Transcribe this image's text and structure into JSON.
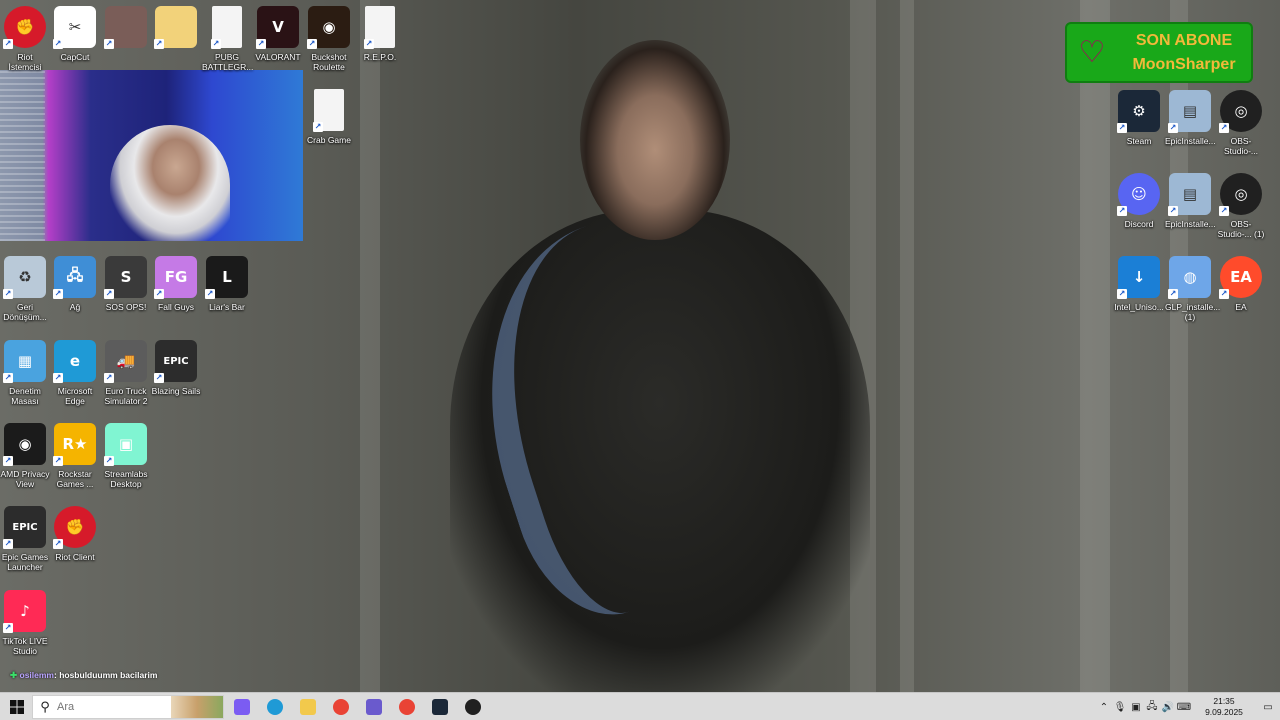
{
  "desktop_icons": [
    {
      "id": "riot-istemcisi",
      "label": "Riot İstemcisi",
      "icon": "riot-fist-icon",
      "color": "#d61a2a"
    },
    {
      "id": "capcut",
      "label": "CapCut",
      "icon": "capcut-icon",
      "color": "#ffffff"
    },
    {
      "id": "user-folder",
      "label": "",
      "icon": "user-photo-icon",
      "color": "#7a5d58"
    },
    {
      "id": "folder",
      "label": "",
      "icon": "folder-icon",
      "color": "#f2d27a"
    },
    {
      "id": "pubg",
      "label": "PUBG BATTLEGR...",
      "icon": "file-icon",
      "color": "#f4f4f4"
    },
    {
      "id": "valorant",
      "label": "VALORANT",
      "icon": "valorant-icon",
      "color": "#2a1215"
    },
    {
      "id": "buckshot",
      "label": "Buckshot Roulette",
      "icon": "buckshot-icon",
      "color": "#2b1c12"
    },
    {
      "id": "repo",
      "label": "R.E.P.O.",
      "icon": "file-icon",
      "color": "#f4f4f4"
    },
    {
      "id": "crab-game",
      "label": "Crab Game",
      "icon": "file-icon",
      "color": "#f4f4f4"
    },
    {
      "id": "geri-donusum",
      "label": "Geri Dönüşüm...",
      "icon": "recycle-bin-icon",
      "color": "#b9c9d8"
    },
    {
      "id": "ag",
      "label": "Ağ",
      "icon": "network-icon",
      "color": "#3f8ed6"
    },
    {
      "id": "sos-ops",
      "label": "SOS OPS!",
      "icon": "sos-ops-icon",
      "color": "#3a3a3a"
    },
    {
      "id": "fall-guys",
      "label": "Fall Guys",
      "icon": "fall-guys-icon",
      "color": "#c57ae6"
    },
    {
      "id": "liars-bar",
      "label": "Liar's Bar",
      "icon": "liars-bar-icon",
      "color": "#1a1a1a"
    },
    {
      "id": "denetim",
      "label": "Denetim Masası",
      "icon": "control-panel-icon",
      "color": "#4aa3df"
    },
    {
      "id": "edge",
      "label": "Microsoft Edge",
      "icon": "edge-icon",
      "color": "#1f9ad6"
    },
    {
      "id": "ets2",
      "label": "Euro Truck Simulator 2",
      "icon": "truck-icon",
      "color": "#5c5c5c"
    },
    {
      "id": "blazing-sails",
      "label": "Blazing Sails",
      "icon": "epic-games-icon",
      "color": "#2c2c2c"
    },
    {
      "id": "amd-privacy",
      "label": "AMD Privacy View",
      "icon": "amd-eye-icon",
      "color": "#1b1b1b"
    },
    {
      "id": "rockstar",
      "label": "Rockstar Games ...",
      "icon": "rockstar-icon",
      "color": "#f5b400"
    },
    {
      "id": "streamlabs",
      "label": "Streamlabs Desktop",
      "icon": "streamlabs-icon",
      "color": "#80f5d2"
    },
    {
      "id": "epic-launcher",
      "label": "Epic Games Launcher",
      "icon": "epic-games-icon",
      "color": "#2c2c2c"
    },
    {
      "id": "riot-client",
      "label": "Riot Client",
      "icon": "riot-fist-icon",
      "color": "#d61a2a"
    },
    {
      "id": "tiktok-live",
      "label": "TikTok LIVE Studio",
      "icon": "tiktok-icon",
      "color": "#ff2a55"
    },
    {
      "id": "steam",
      "label": "Steam",
      "icon": "steam-icon",
      "color": "#1b2838"
    },
    {
      "id": "epic-installer-1",
      "label": "EpicInstalle...",
      "icon": "installer-icon",
      "color": "#9db8d4"
    },
    {
      "id": "obs-1",
      "label": "OBS-Studio-...",
      "icon": "obs-icon",
      "color": "#202020"
    },
    {
      "id": "discord",
      "label": "Discord",
      "icon": "discord-icon",
      "color": "#5865f2"
    },
    {
      "id": "epic-installer-2",
      "label": "EpicInstalle...",
      "icon": "installer-icon",
      "color": "#9db8d4"
    },
    {
      "id": "obs-2",
      "label": "OBS-Studio-... (1)",
      "icon": "obs-icon",
      "color": "#202020"
    },
    {
      "id": "intel-unison",
      "label": "Intel_Uniso...",
      "icon": "download-icon",
      "color": "#1b7fd6"
    },
    {
      "id": "glp-installer",
      "label": "GLP_installe... (1)",
      "icon": "glp-icon",
      "color": "#6ea6e8"
    },
    {
      "id": "ea",
      "label": "EA",
      "icon": "ea-icon",
      "color": "#ff4b2b"
    }
  ],
  "overlay": {
    "subscriber_title": "SON ABONE",
    "subscriber_name": "MoonSharper",
    "heart_icon": "heart-icon"
  },
  "chat": {
    "user": "osilemm",
    "message": ": hosbulduumm bacilarim"
  },
  "taskbar": {
    "search_placeholder": "Ara",
    "pinned": [
      "copilot-icon",
      "edge-icon",
      "file-explorer-icon",
      "chrome-icon",
      "streamlabs-icon",
      "chrome-icon",
      "steam-icon",
      "obs-icon"
    ],
    "time": "21:35",
    "date": "9.09.2025"
  },
  "colors": {
    "taskbar_bg": "#dcdcdc",
    "overlay_bg": "#19a819",
    "overlay_text": "#f2b93a"
  }
}
